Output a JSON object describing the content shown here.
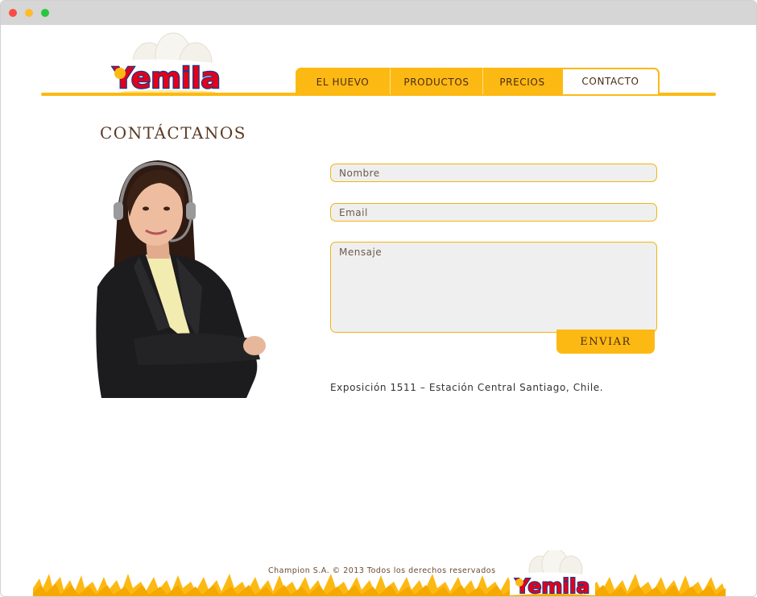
{
  "window": {
    "controls": [
      "close",
      "minimize",
      "maximize"
    ]
  },
  "brand": {
    "logo_text": "Yemila",
    "accent": "#fdb913",
    "logo_red": "#e2001a",
    "logo_blue": "#1e3a8a"
  },
  "nav": {
    "items": [
      {
        "label": "EL HUEVO"
      },
      {
        "label": "PRODUCTOS"
      },
      {
        "label": "PRECIOS"
      },
      {
        "label": "CONTACTO",
        "active": true
      }
    ]
  },
  "page": {
    "title": "CONTÁCTANOS"
  },
  "form": {
    "nombre_placeholder": "Nombre",
    "email_placeholder": "Email",
    "mensaje_placeholder": "Mensaje",
    "send_label": "ENVIAR"
  },
  "address": "Exposición 1511 – Estación Central Santiago, Chile.",
  "footer": {
    "copyright": "Champion S.A. © 2013 Todos los derechos reservados",
    "logo_text": "Yemila"
  }
}
